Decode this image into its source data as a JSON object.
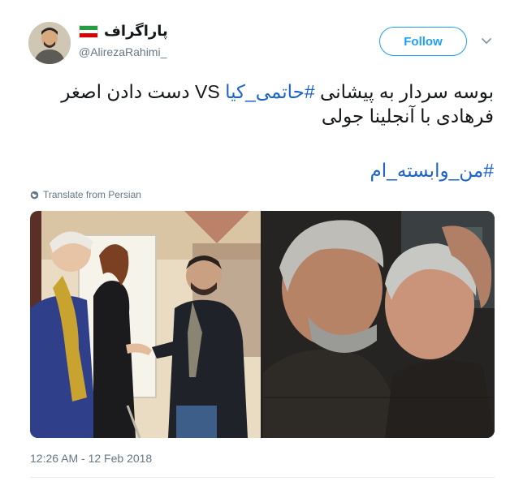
{
  "author": {
    "display_name": "پاراگراف",
    "handle": "@AlirezaRahimi_",
    "avatar_icon": "avatar-photo",
    "flag_icon": "iran-flag-icon",
    "flag_colors": [
      "#239f40",
      "#ffffff",
      "#da0000"
    ]
  },
  "actions": {
    "follow_label": "Follow",
    "menu_icon": "chevron-down-icon"
  },
  "tweet": {
    "line1_prefix": "بوسه سردار به پیشانی ",
    "line1_hashtag": "#حاتمی_کیا",
    "line1_suffix": " VS دست دادن اصغر",
    "line2": "فرهادی با آنجلینا جولی",
    "hashtag_line": "#من_وابسته_ام"
  },
  "translate_label": "Translate from Persian",
  "timestamp": "12:26 AM - 12 Feb 2018",
  "colors": {
    "accent": "#1da1f2",
    "hashtag": "#1b63c7",
    "muted": "#657786"
  },
  "media": {
    "left_photo": "photo-handshake",
    "right_photo": "photo-forehead-kiss"
  }
}
